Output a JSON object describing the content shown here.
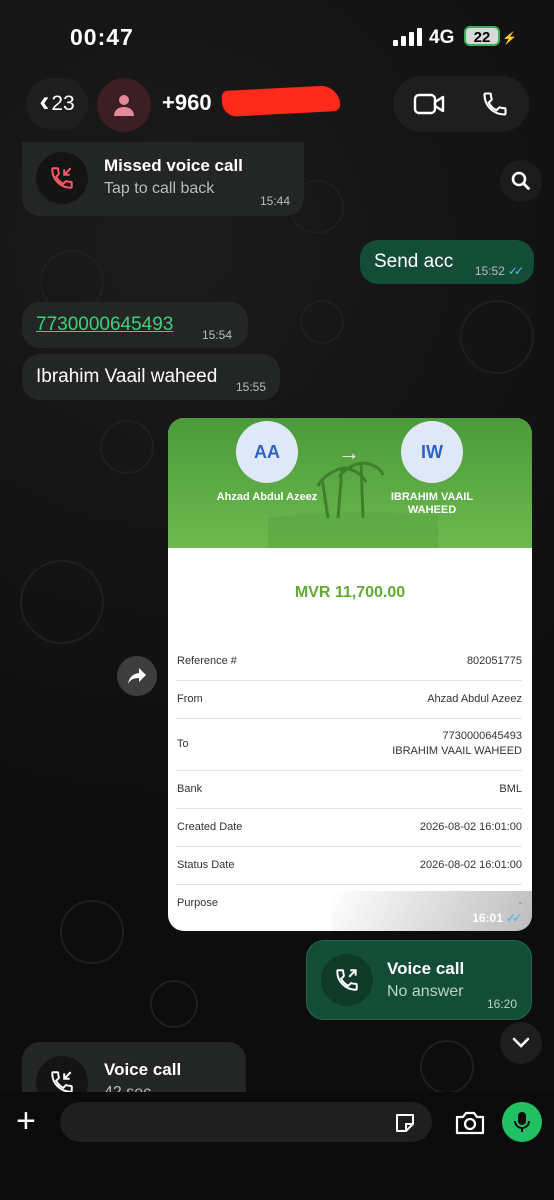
{
  "status_bar": {
    "time": "00:47",
    "network": "4G",
    "battery": "22"
  },
  "header": {
    "back_count": "23",
    "contact_name": "+960"
  },
  "messages": {
    "missed_call": {
      "title": "Missed voice call",
      "subtitle": "Tap to call back",
      "time": "15:44"
    },
    "send_acc": {
      "text": "Send acc",
      "time": "15:52"
    },
    "account_number": {
      "text": "7730000645493",
      "time": "15:54"
    },
    "name_msg": {
      "text": "Ibrahim Vaail waheed",
      "time": "15:55"
    },
    "voice_call_out": {
      "title": "Voice call",
      "subtitle": "No answer",
      "time": "16:20"
    },
    "voice_call_in": {
      "title": "Voice call",
      "subtitle": "42 sec"
    }
  },
  "receipt": {
    "from_initials": "AA",
    "to_initials": "IW",
    "from_name": "Ahzad Abdul Azeez",
    "to_name": "IBRAHIM VAAIL WAHEED",
    "amount": "MVR 11,700.00",
    "rows": [
      {
        "label": "Reference #",
        "value": "802051775"
      },
      {
        "label": "From",
        "value": "Ahzad Abdul Azeez"
      },
      {
        "label": "To",
        "value": "7730000645493",
        "value2": "IBRAHIM VAAIL WAHEED"
      },
      {
        "label": "Bank",
        "value": "BML"
      },
      {
        "label": "Created Date",
        "value": "2026-08-02 16:01:00"
      },
      {
        "label": "Status Date",
        "value": "2026-08-02 16:01:00"
      },
      {
        "label": "Purpose",
        "value": "-"
      }
    ],
    "time": "16:01"
  },
  "composer": {
    "placeholder": ""
  },
  "colors": {
    "outgoing_bubble": "#144d37",
    "incoming_bubble": "#242626",
    "accent_green": "#21c063",
    "read_ticks": "#53bdeb",
    "amount_green": "#63a933"
  }
}
